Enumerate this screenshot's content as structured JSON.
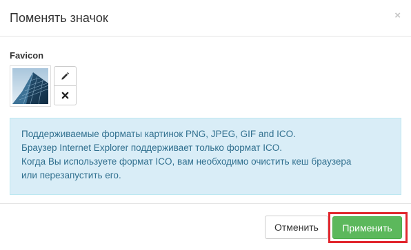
{
  "dialog": {
    "title": "Поменять значок",
    "close_glyph": "×"
  },
  "favicon": {
    "label": "Favicon",
    "edit_icon": "pencil-icon",
    "remove_icon": "times-icon"
  },
  "info": {
    "lines": [
      "Поддерживаемые форматы картинок PNG, JPEG, GIF and ICO.",
      "Браузер Internet Explorer поддерживает только формат ICO.",
      "Когда Вы используете формат ICO, вам необходимо очистить кеш браузера",
      "или перезапустить его."
    ]
  },
  "footer": {
    "cancel_label": "Отменить",
    "apply_label": "Применить"
  },
  "colors": {
    "info_bg": "#d9edf7",
    "info_text": "#31708f",
    "apply_bg": "#5cb85c",
    "highlight": "#e1262d"
  }
}
